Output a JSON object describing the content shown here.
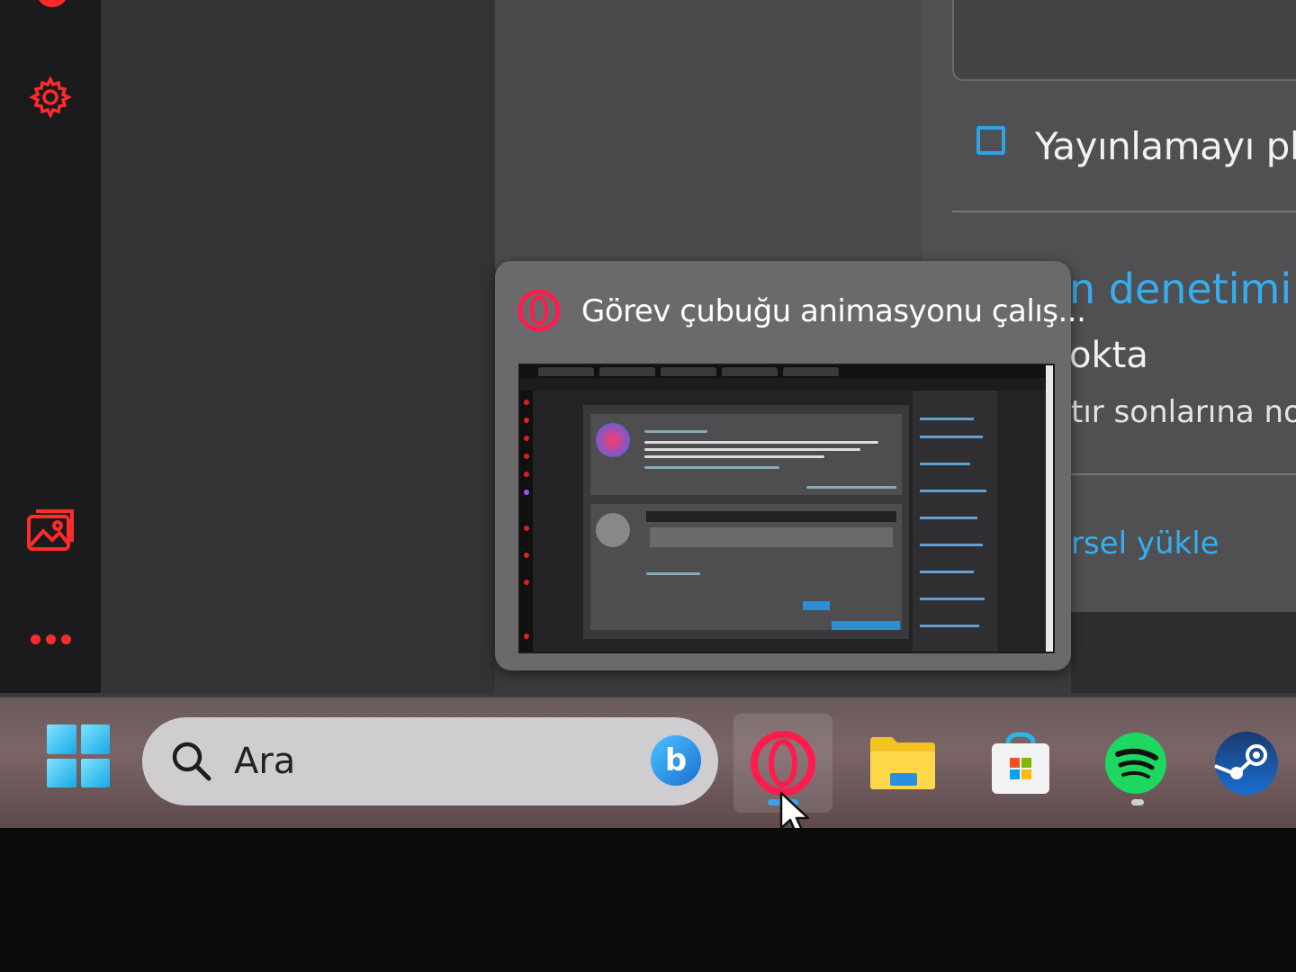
{
  "sidebar": {
    "icons": [
      "settings-gear-icon",
      "image-gallery-icon",
      "more-dots-icon"
    ],
    "accent": "#ff2a2a"
  },
  "settings_panel": {
    "checkbox_label": "Yayınlamayı pla",
    "section_title_partial": "n denetimi",
    "line_partial_1": "okta",
    "line_partial_2": "tır sonlarına no",
    "upload_partial": "rsel yükle"
  },
  "preview": {
    "title": "Görev çubuğu animasyonu çalış..."
  },
  "taskbar": {
    "search_placeholder": "Ara",
    "apps": [
      "start-icon",
      "bing-icon",
      "opera-icon",
      "file-explorer-icon",
      "microsoft-store-icon",
      "spotify-icon",
      "steam-icon"
    ],
    "active_indicator_color": "#3da2e8"
  },
  "colors": {
    "link_blue": "#35aef0",
    "opera_red": "#ff1b4d",
    "checkbox_blue": "#2ea3e6"
  }
}
